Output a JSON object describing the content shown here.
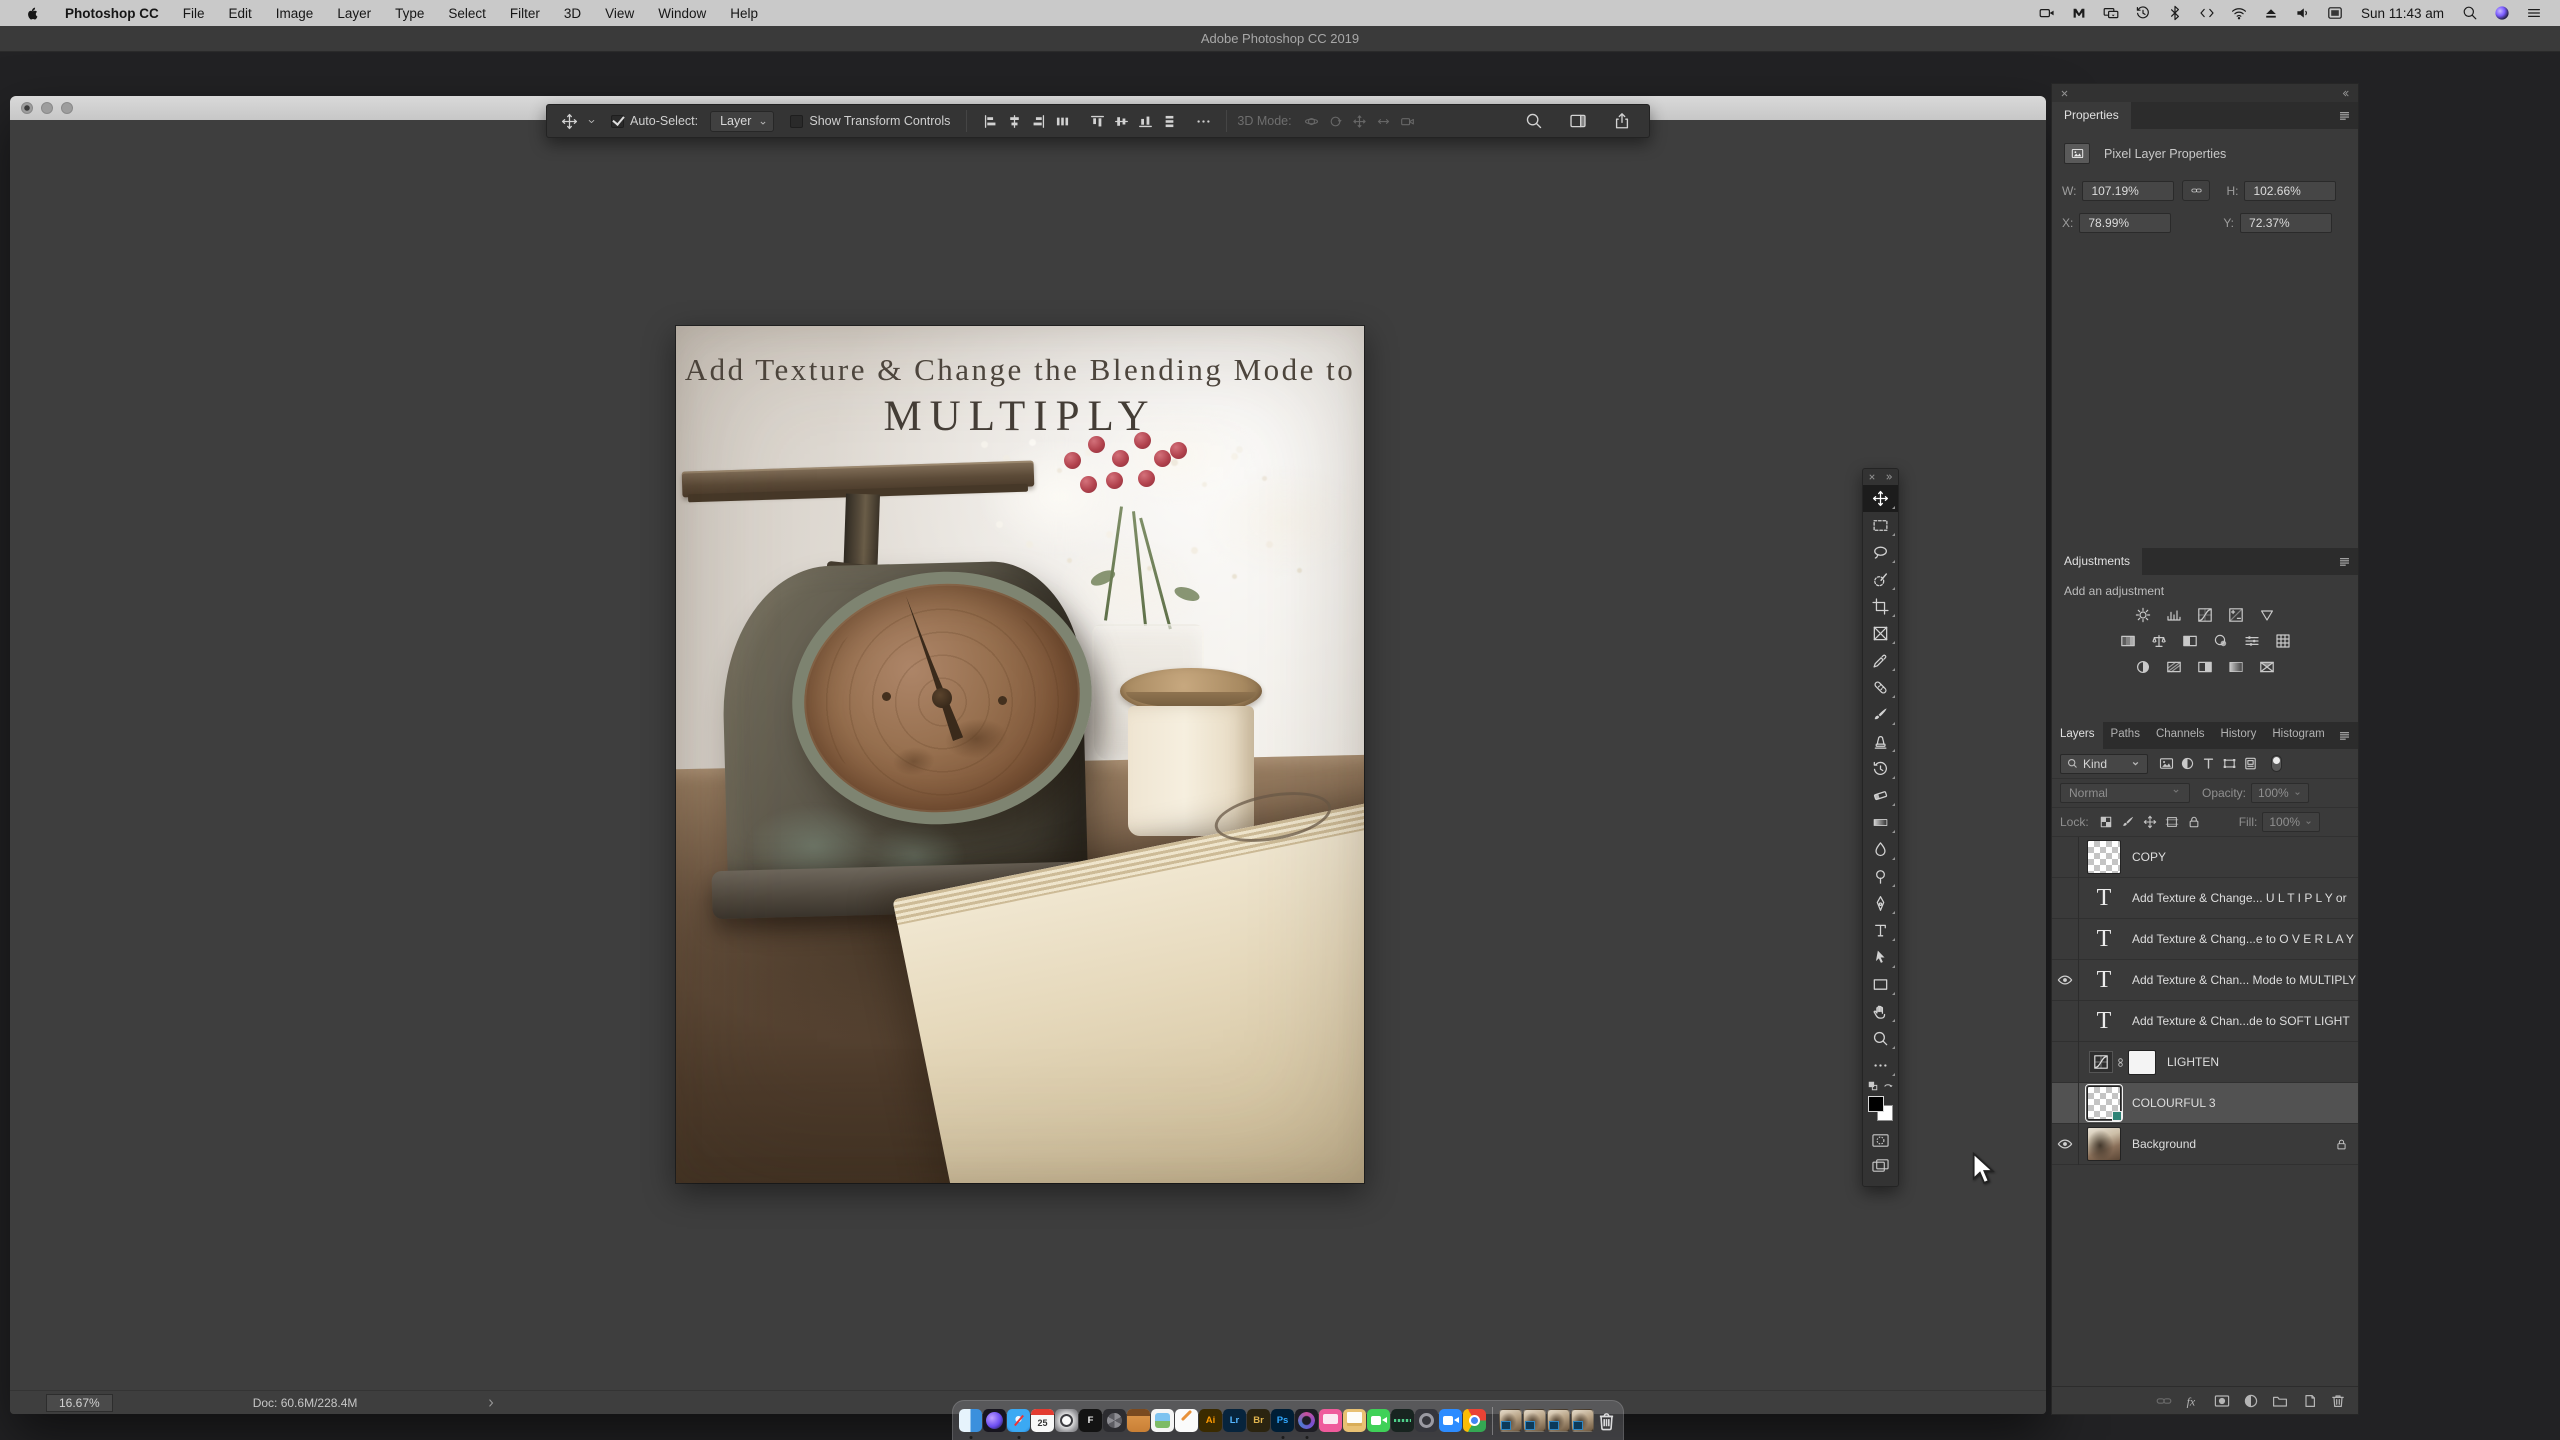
{
  "colors": {
    "menu_bar_bg": "#c9c9c9",
    "app_title_bar_bg": "#3a3a3a",
    "pasteboard_bg": "#3e3e3e",
    "panel_bg": "#3a3a3a",
    "selected_layer_bg": "#525252",
    "photoshop_blue": "#31a8ff"
  },
  "menu_bar": {
    "app_name": "Photoshop CC",
    "menus": [
      "File",
      "Edit",
      "Image",
      "Layer",
      "Type",
      "Select",
      "Filter",
      "3D",
      "View",
      "Window",
      "Help"
    ],
    "status_icons": [
      "screen-record",
      "malwarebytes",
      "display-mirror",
      "time-machine",
      "bluetooth",
      "code-brackets",
      "wifi",
      "eject",
      "volume",
      "input-source"
    ],
    "clock": "Sun 11:43 am",
    "trailing_icons": [
      "spotlight",
      "siri",
      "notification-center"
    ]
  },
  "app_title_bar": {
    "title": "Adobe Photoshop CC 2019"
  },
  "options_bar": {
    "auto_select_label": "Auto-Select:",
    "auto_select_checked": true,
    "target_value": "Layer",
    "show_transform_label": "Show Transform Controls",
    "show_transform_checked": false,
    "align_icons_1": [
      "align-left",
      "align-center-h",
      "align-right",
      "distribute-h"
    ],
    "align_icons_2": [
      "align-top",
      "align-middle",
      "align-bottom",
      "distribute-v"
    ],
    "mode_label": "3D Mode:",
    "mode_icons": [
      "orbit-3d",
      "roll-3d",
      "pan-3d",
      "slide-3d",
      "camera-3d"
    ],
    "right_icons": [
      "search",
      "workspace",
      "share"
    ]
  },
  "toolbar": {
    "tools": [
      {
        "name": "move",
        "selected": true
      },
      {
        "name": "rect-marquee"
      },
      {
        "name": "lasso"
      },
      {
        "name": "quick-select"
      },
      {
        "name": "crop"
      },
      {
        "name": "frame"
      },
      {
        "name": "eyedropper"
      },
      {
        "name": "healing-brush"
      },
      {
        "name": "brush"
      },
      {
        "name": "clone-stamp"
      },
      {
        "name": "history-brush"
      },
      {
        "name": "eraser"
      },
      {
        "name": "gradient"
      },
      {
        "name": "blur"
      },
      {
        "name": "dodge"
      },
      {
        "name": "pen"
      },
      {
        "name": "type"
      },
      {
        "name": "path-select"
      },
      {
        "name": "rectangle"
      },
      {
        "name": "hand"
      },
      {
        "name": "zoom"
      },
      {
        "name": "edit-toolbar"
      }
    ],
    "foreground_color": "#000000",
    "background_color": "#ffffff"
  },
  "canvas": {
    "title_line1": "Add Texture & Change the Blending Mode to",
    "title_line2": "MULTIPLY"
  },
  "status_bar": {
    "zoom": "16.67%",
    "doc_sizes": "Doc: 60.6M/228.4M"
  },
  "panels": {
    "properties": {
      "tab": "Properties",
      "subtitle": "Pixel Layer Properties",
      "w_label": "W:",
      "w_value": "107.19%",
      "h_label": "H:",
      "h_value": "102.66%",
      "x_label": "X:",
      "x_value": "78.99%",
      "y_label": "Y:",
      "y_value": "72.37%"
    },
    "adjustments": {
      "tab": "Adjustments",
      "hint": "Add an adjustment",
      "rows": [
        [
          "brightness-contrast",
          "levels",
          "curves",
          "exposure",
          "vibrance"
        ],
        [
          "hue-saturation",
          "color-balance",
          "black-white",
          "photo-filter",
          "channel-mixer",
          "color-lookup"
        ],
        [
          "invert",
          "posterize",
          "threshold",
          "gradient-map",
          "selective-color"
        ]
      ]
    },
    "layers": {
      "tabs": [
        "Layers",
        "Paths",
        "Channels",
        "History",
        "Histogram"
      ],
      "active_tab": 0,
      "kind_value": "Kind",
      "filter_icons": [
        "pixel-layers",
        "adjustment-layers",
        "type-layers",
        "shape-layers",
        "smart-objects"
      ],
      "blend_mode": "Normal",
      "opacity_label": "Opacity:",
      "opacity_value": "100%",
      "lock_label": "Lock:",
      "lock_icons": [
        "lock-transparent",
        "lock-pixels",
        "lock-position",
        "lock-artboard",
        "lock-all"
      ],
      "fill_label": "Fill:",
      "fill_value": "100%",
      "rows": [
        {
          "name": "COPY",
          "kind": "pixel",
          "eye": false
        },
        {
          "name": "Add Texture & Change... U L T I P L Y  or",
          "kind": "text",
          "eye": false
        },
        {
          "name": "Add Texture & Chang...e to O V E R L A Y",
          "kind": "text",
          "eye": false
        },
        {
          "name": "Add Texture & Chan... Mode to MULTIPLY",
          "kind": "text",
          "eye": true
        },
        {
          "name": "Add Texture & Chan...de to SOFT  LIGHT",
          "kind": "text",
          "eye": false
        },
        {
          "name": "LIGHTEN",
          "kind": "adjustment",
          "eye": false
        },
        {
          "name": "COLOURFUL 3",
          "kind": "pixel",
          "eye": false,
          "selected": true
        },
        {
          "name": "Background",
          "kind": "image",
          "eye": true,
          "locked": true
        }
      ],
      "footer_icons": [
        "link-layers",
        "layer-style",
        "layer-mask",
        "new-adjustment",
        "new-group",
        "new-layer",
        "delete-layer"
      ]
    }
  },
  "dock": {
    "apps": [
      {
        "name": "finder",
        "running": true
      },
      {
        "name": "siri"
      },
      {
        "name": "safari",
        "running": true
      },
      {
        "name": "calendar",
        "label": "25"
      },
      {
        "name": "quicktime"
      },
      {
        "name": "fontexplorer",
        "label": "F"
      },
      {
        "name": "camera-app"
      },
      {
        "name": "notes-app"
      },
      {
        "name": "photos-app"
      },
      {
        "name": "pages-app"
      },
      {
        "name": "illustrator",
        "label": "Ai"
      },
      {
        "name": "lightroom",
        "label": "Lr"
      },
      {
        "name": "bridge",
        "label": "Br"
      },
      {
        "name": "photoshop",
        "label": "Ps",
        "running": true
      },
      {
        "name": "media-app",
        "running": true
      },
      {
        "name": "display-app"
      },
      {
        "name": "files-app"
      },
      {
        "name": "facetime"
      },
      {
        "name": "audio-app"
      },
      {
        "name": "settings-app"
      },
      {
        "name": "zoom-app"
      },
      {
        "name": "chrome"
      }
    ],
    "document_count": 4
  }
}
